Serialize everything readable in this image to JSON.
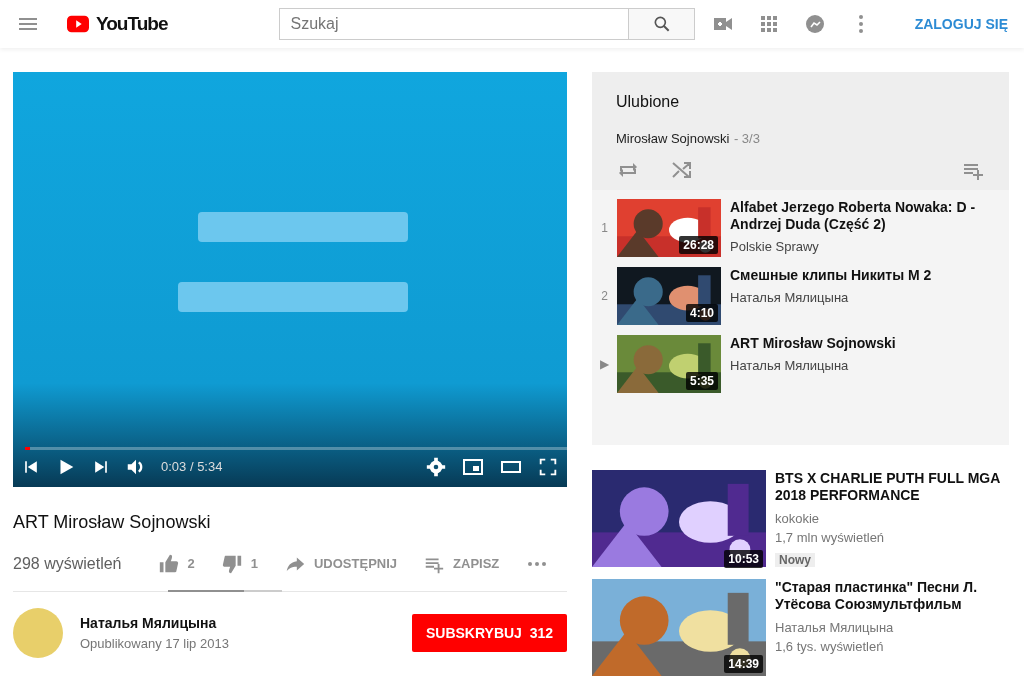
{
  "header": {
    "logo_text": "YouTube",
    "search": {
      "placeholder": "Szukaj"
    },
    "sign_in": "ZALOGUJ SIĘ"
  },
  "player": {
    "progress": {
      "level": 0.01
    },
    "time": "0:03 / 5:34"
  },
  "video": {
    "title": "ART Mirosław Sojnowski",
    "views": "298 wyświetleń",
    "likes": "2",
    "dislikes": "1",
    "rating_bar": {
      "level": 0.67
    },
    "share": "UDOSTĘPNIJ",
    "save": "ZAPISZ"
  },
  "channel": {
    "name": "Наталья Мялицына",
    "published": "Opublikowany 17 lip 2013",
    "subscribe": "SUBSKRYBUJ",
    "subscribers": "312"
  },
  "playlist": {
    "title": "Ulubione",
    "owner": "Mirosław Sojnowski",
    "position": "- 3/3",
    "items": [
      {
        "marker": "1",
        "title": "Alfabet Jerzego Roberta Nowaka: D - Andrzej Duda (Część 2)",
        "channel": "Polskie Sprawy",
        "duration": "26:28"
      },
      {
        "marker": "2",
        "title": "Смешные клипы Никиты М 2",
        "channel": "Наталья Мялицына",
        "duration": "4:10"
      },
      {
        "marker": "▶",
        "title": "ART Mirosław Sojnowski",
        "channel": "Наталья Мялицына",
        "duration": "5:35"
      }
    ]
  },
  "recommended": [
    {
      "title": "BTS X CHARLIE PUTH FULL MGA 2018 PERFORMANCE",
      "channel": "kokokie",
      "views": "1,7 mln wyświetleń",
      "badge": "Nowy",
      "duration": "10:53"
    },
    {
      "title": "\"Старая пластинка\" Песни Л. Утёсова Союзмультфильм",
      "channel": "Наталья Мялицына",
      "views": "1,6 tys. wyświetleń",
      "duration": "14:39"
    }
  ]
}
